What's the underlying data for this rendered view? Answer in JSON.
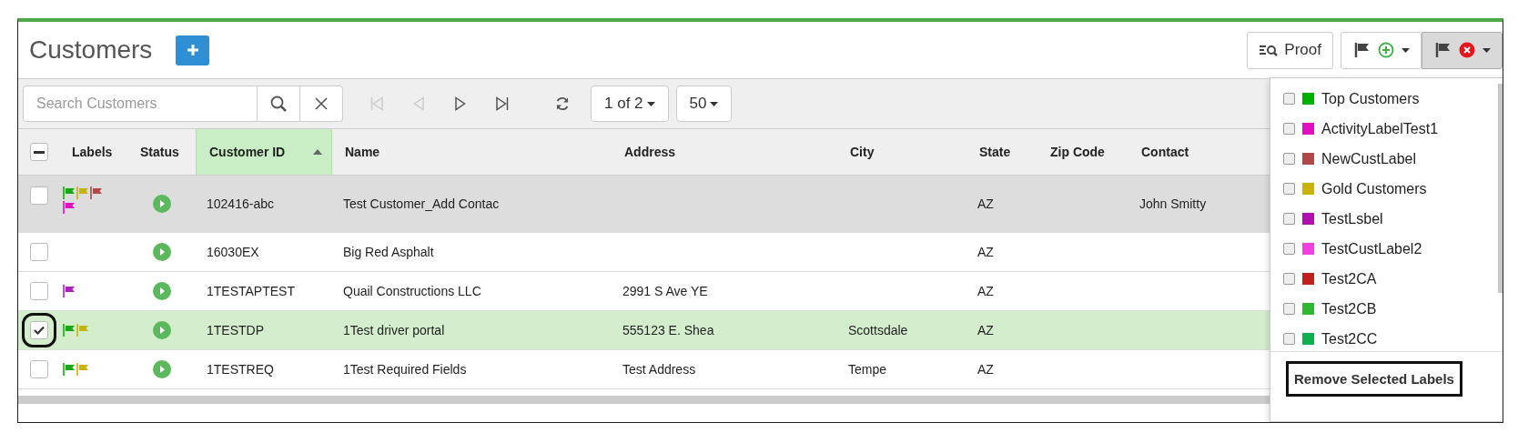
{
  "header": {
    "title": "Customers",
    "actions": [
      {
        "kind": "proof",
        "label": "Proof"
      },
      {
        "kind": "add-label",
        "open": false
      },
      {
        "kind": "remove-label",
        "open": true
      }
    ]
  },
  "toolbar": {
    "search": {
      "placeholder": "Search Customers"
    },
    "pager": [
      {
        "kind": "first",
        "disabled": true
      },
      {
        "kind": "prev",
        "disabled": true
      },
      {
        "kind": "next",
        "disabled": false
      },
      {
        "kind": "last",
        "disabled": false
      },
      {
        "kind": "refresh",
        "disabled": false
      }
    ],
    "page": "1 of 2",
    "page_size": "50"
  },
  "table": {
    "select_all": {
      "indeterminate": true
    },
    "columns": [
      {
        "label": "Labels",
        "sorted": false
      },
      {
        "label": "Status",
        "sorted": false
      },
      {
        "label": "Customer ID",
        "sorted": true
      },
      {
        "label": "Name",
        "sorted": false
      },
      {
        "label": "Address",
        "sorted": false
      },
      {
        "label": "City",
        "sorted": false
      },
      {
        "label": "State",
        "sorted": false
      },
      {
        "label": "Zip Code",
        "sorted": false
      },
      {
        "label": "Contact",
        "sorted": false
      }
    ],
    "rows": [
      {
        "selected": false,
        "hovered": true,
        "labels": [
          {
            "color": "#17a817"
          },
          {
            "color": "#c8b400"
          },
          {
            "color": "#b04848"
          },
          {
            "color": "#e010c0"
          }
        ],
        "id": "102416-abc",
        "name": "Test Customer_Add Contac",
        "address": "",
        "city": "",
        "state": "AZ",
        "zip": "",
        "contact": "John Smitty"
      },
      {
        "selected": false,
        "hovered": false,
        "labels": [],
        "id": "16030EX",
        "name": "Big Red Asphalt",
        "address": "",
        "city": "",
        "state": "AZ",
        "zip": "",
        "contact": ""
      },
      {
        "selected": false,
        "hovered": false,
        "labels": [
          {
            "color": "#b020c0"
          }
        ],
        "id": "1TESTAPTEST",
        "name": "Quail Constructions LLC",
        "address": "2991 S Ave YE",
        "city": "",
        "state": "AZ",
        "zip": "",
        "contact": ""
      },
      {
        "selected": true,
        "hovered": false,
        "labels": [
          {
            "color": "#17a817"
          },
          {
            "color": "#c8b400"
          }
        ],
        "id": "1TESTDP",
        "name": "1Test driver portal",
        "address": "555123 E. Shea",
        "city": "Scottsdale",
        "state": "AZ",
        "zip": "",
        "contact": ""
      },
      {
        "selected": false,
        "hovered": false,
        "labels": [
          {
            "color": "#17a817"
          },
          {
            "color": "#c8b400"
          }
        ],
        "id": "1TESTREQ",
        "name": "1Test Required Fields",
        "address": "Test Address",
        "city": "Tempe",
        "state": "AZ",
        "zip": "",
        "contact": ""
      }
    ]
  },
  "label_menu": {
    "items": [
      {
        "label": "Top Customers",
        "color": "#00b000",
        "checked": false
      },
      {
        "label": "ActivityLabelTest1",
        "color": "#e010c0",
        "checked": false
      },
      {
        "label": "NewCustLabel",
        "color": "#b04848",
        "checked": false
      },
      {
        "label": "Gold Customers",
        "color": "#c8b400",
        "checked": false
      },
      {
        "label": "TestLsbel",
        "color": "#b010b0",
        "checked": false
      },
      {
        "label": "TestCustLabel2",
        "color": "#f040e0",
        "checked": false
      },
      {
        "label": "Test2CA",
        "color": "#c02020",
        "checked": false
      },
      {
        "label": "Test2CB",
        "color": "#30b830",
        "checked": false
      },
      {
        "label": "Test2CC",
        "color": "#10b050",
        "checked": false
      }
    ],
    "button": "Remove Selected Labels"
  }
}
